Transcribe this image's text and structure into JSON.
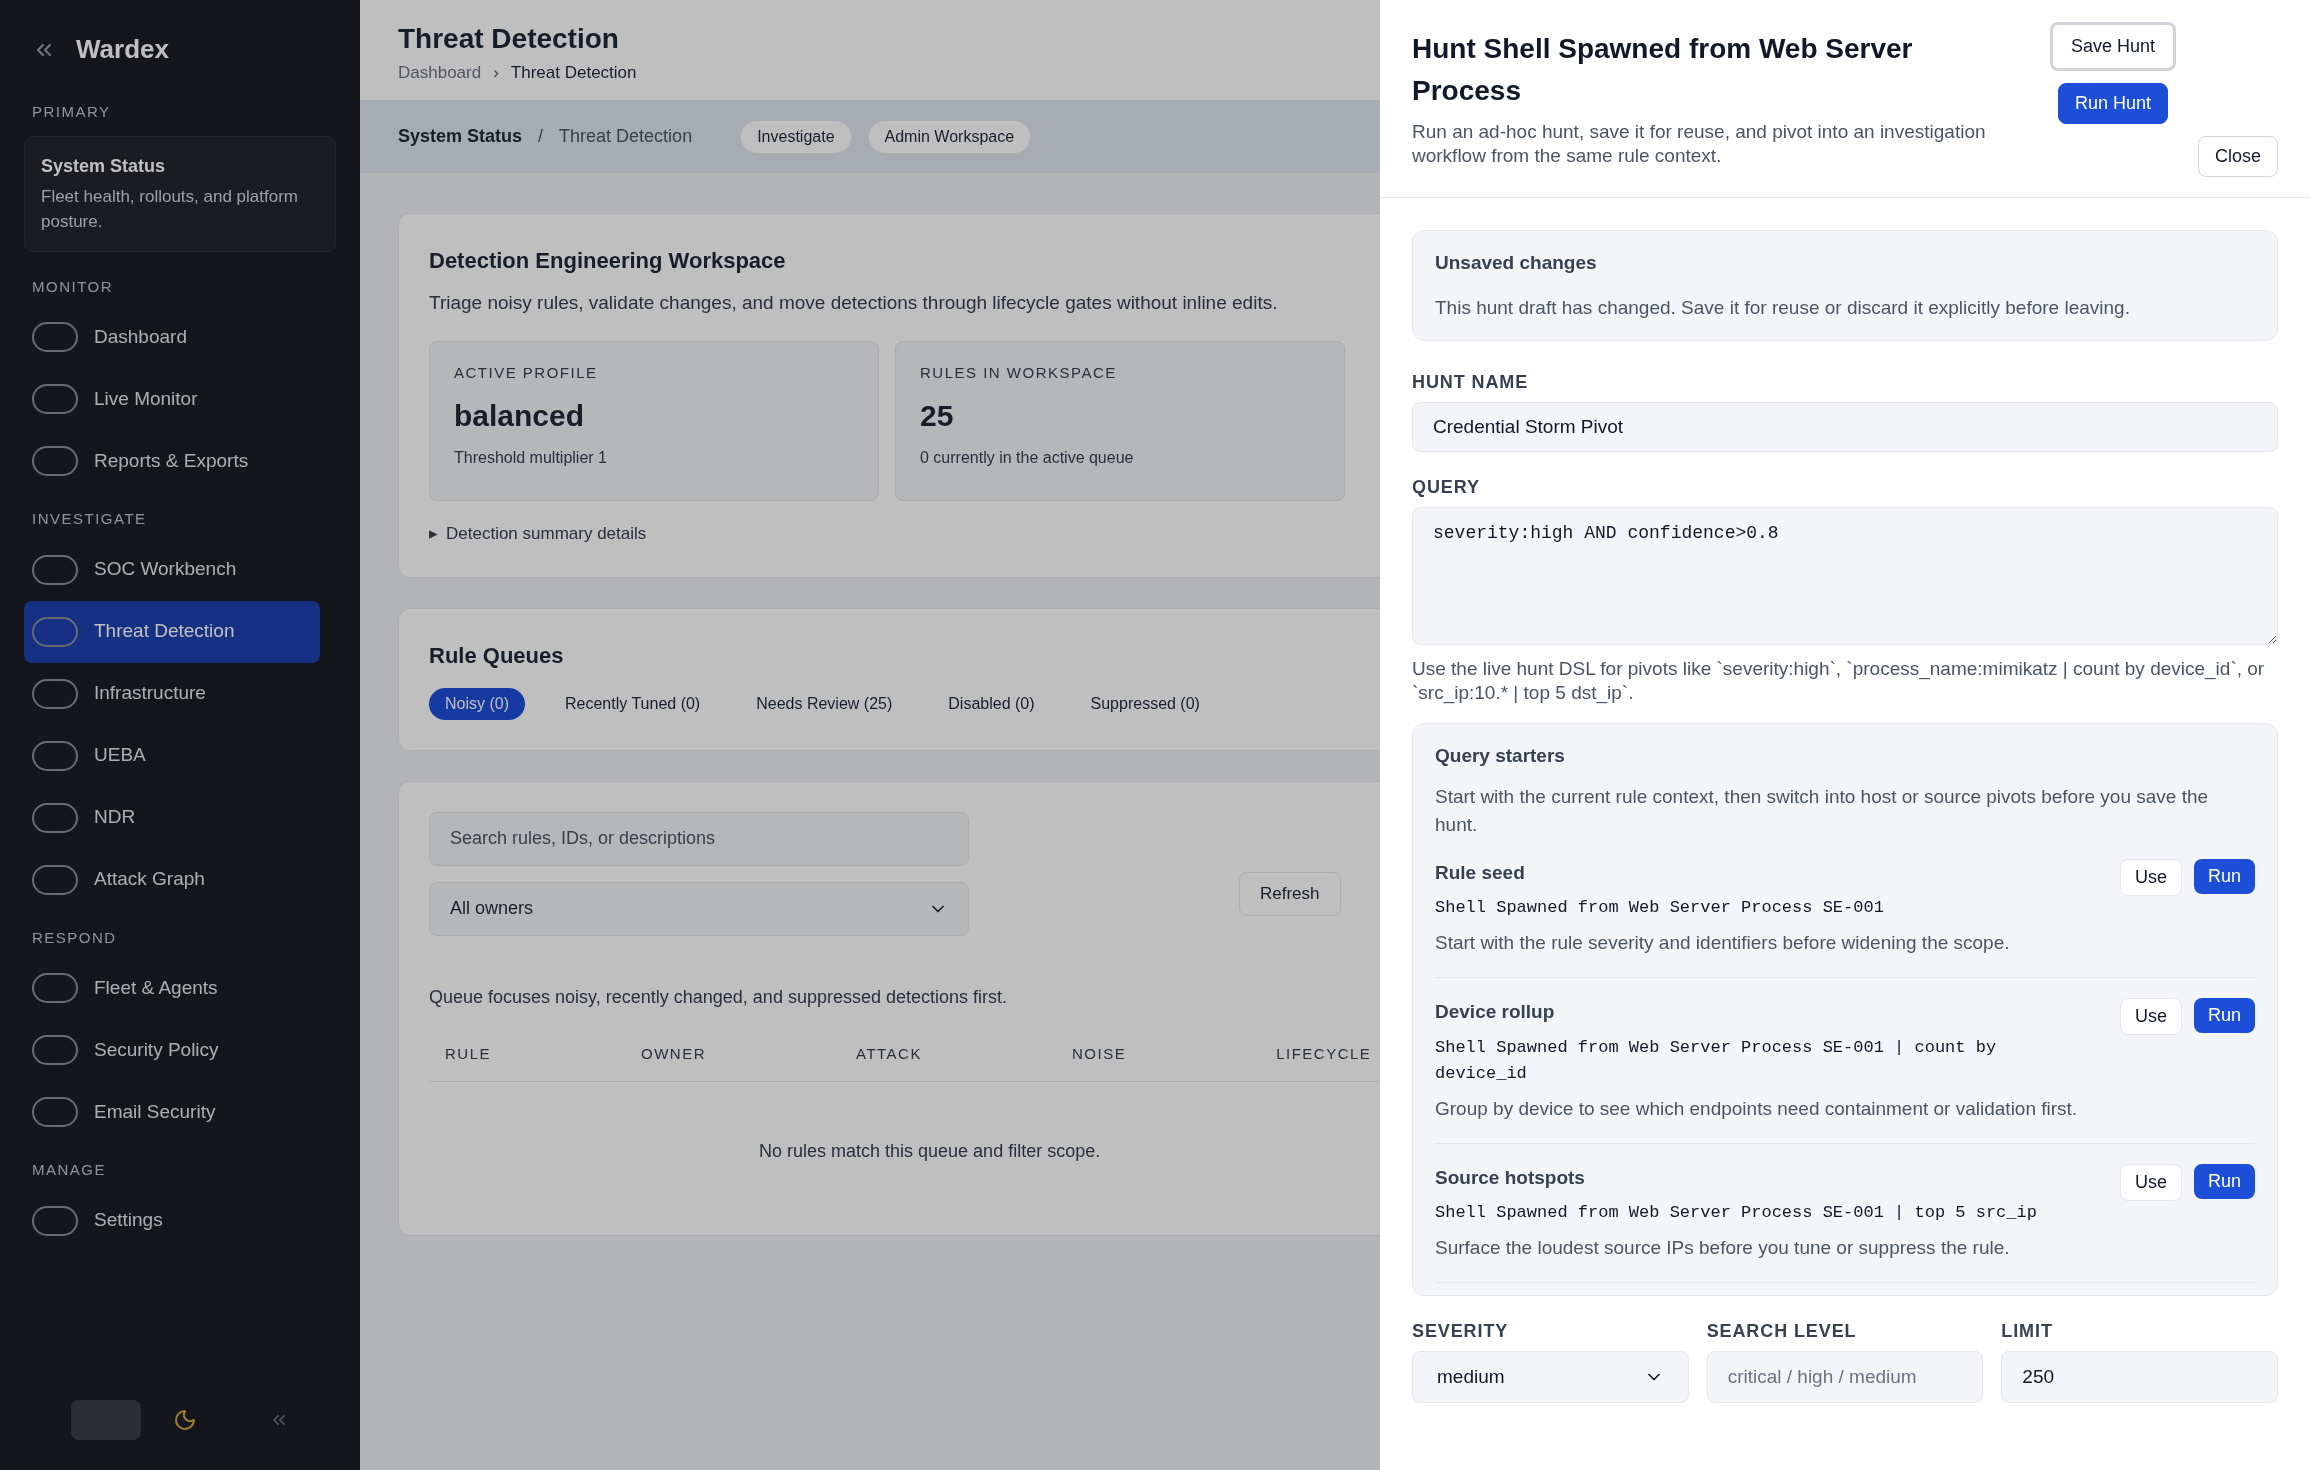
{
  "sidebar": {
    "brand": "Wardex",
    "primary": {
      "label": "PRIMARY",
      "title": "System Status",
      "description": "Fleet health, rollouts, and platform posture."
    },
    "sections": [
      {
        "label": "MONITOR",
        "items": [
          {
            "label": "Dashboard",
            "selected": false
          },
          {
            "label": "Live Monitor",
            "selected": false
          },
          {
            "label": "Reports & Exports",
            "selected": false
          }
        ]
      },
      {
        "label": "INVESTIGATE",
        "items": [
          {
            "label": "SOC Workbench",
            "selected": false
          },
          {
            "label": "Threat Detection",
            "selected": true
          },
          {
            "label": "Infrastructure",
            "selected": false
          },
          {
            "label": "UEBA",
            "selected": false
          },
          {
            "label": "NDR",
            "selected": false
          },
          {
            "label": "Attack Graph",
            "selected": false
          }
        ]
      },
      {
        "label": "RESPOND",
        "items": [
          {
            "label": "Fleet & Agents",
            "selected": false
          },
          {
            "label": "Security Policy",
            "selected": false
          },
          {
            "label": "Email Security",
            "selected": false
          }
        ]
      },
      {
        "label": "MANAGE",
        "items": [
          {
            "label": "Settings",
            "selected": false
          }
        ]
      }
    ]
  },
  "header": {
    "title": "Threat Detection",
    "breadcrumb": [
      "Dashboard",
      "Threat Detection"
    ],
    "separator": "›"
  },
  "context_bar": {
    "path": [
      "System Status",
      "Threat Detection"
    ],
    "separator": "/",
    "chips": [
      "Investigate",
      "Admin Workspace"
    ]
  },
  "workspace": {
    "title": "Detection Engineering Workspace",
    "description": "Triage noisy rules, validate changes, and move detections through lifecycle gates without inline edits.",
    "stats": [
      {
        "label": "ACTIVE PROFILE",
        "value": "balanced",
        "note": "Threshold multiplier 1"
      },
      {
        "label": "RULES IN WORKSPACE",
        "value": "25",
        "note": "0 currently in the active queue"
      }
    ],
    "details_marker": "▸",
    "details": "Detection summary details"
  },
  "queues": {
    "title": "Rule Queues",
    "tabs": [
      {
        "label": "Noisy (0)",
        "selected": true
      },
      {
        "label": "Recently Tuned (0)",
        "selected": false
      },
      {
        "label": "Needs Review (25)",
        "selected": false
      },
      {
        "label": "Disabled (0)",
        "selected": false
      },
      {
        "label": "Suppressed (0)",
        "selected": false
      }
    ],
    "search": {
      "placeholder": "Search rules, IDs, or descriptions"
    },
    "owner": "All owners",
    "refresh": "Refresh",
    "note": "Queue focuses noisy, recently changed, and suppressed detections first.",
    "columns": [
      "RULE",
      "OWNER",
      "ATTACK",
      "NOISE",
      "LIFECYCLE"
    ],
    "empty": "No rules match this queue and filter scope."
  },
  "drawer": {
    "title": "Hunt Shell Spawned from Web Server Process",
    "subtitle": "Run an ad-hoc hunt, save it for reuse, and pivot into an investigation workflow from the same rule context.",
    "buttons": [
      {
        "label": "Save Hunt",
        "kind": "outline",
        "focused": true
      },
      {
        "label": "Run Hunt",
        "kind": "primary",
        "focused": false
      },
      {
        "label": "Close",
        "kind": "outline",
        "focused": false
      }
    ],
    "notice": {
      "title": "Unsaved changes",
      "text": "This hunt draft has changed. Save it for reuse or discard it explicitly before leaving."
    },
    "hunt_name": {
      "label": "HUNT NAME",
      "value": "Credential Storm Pivot"
    },
    "query": {
      "label": "QUERY",
      "value": "severity:high AND confidence>0.8",
      "help": "Use the live hunt DSL for pivots like `severity:high`, `process_name:mimikatz | count by device_id`, or `src_ip:10.* | top 5 dst_ip`."
    },
    "starters": {
      "title": "Query starters",
      "description": "Start with the current rule context, then switch into host or source pivots before you save the hunt.",
      "items": [
        {
          "title": "Rule seed",
          "query": "Shell Spawned from Web Server Process SE-001",
          "description": "Start with the rule severity and identifiers before widening the scope.",
          "use": "Use",
          "run": "Run"
        },
        {
          "title": "Device rollup",
          "query": "Shell Spawned from Web Server Process SE-001 | count by device_id",
          "description": "Group by device to see which endpoints need containment or validation first.",
          "use": "Use",
          "run": "Run"
        },
        {
          "title": "Source hotspots",
          "query": "Shell Spawned from Web Server Process SE-001 | top 5 src_ip",
          "description": "Surface the loudest source IPs before you tune or suppress the rule.",
          "use": "Use",
          "run": "Run"
        }
      ]
    },
    "fields": [
      {
        "kind": "select",
        "label": "SEVERITY",
        "value": "medium"
      },
      {
        "kind": "input",
        "label": "SEARCH LEVEL",
        "placeholder": "critical / high / medium"
      },
      {
        "kind": "input",
        "label": "LIMIT",
        "value": "250"
      }
    ]
  }
}
